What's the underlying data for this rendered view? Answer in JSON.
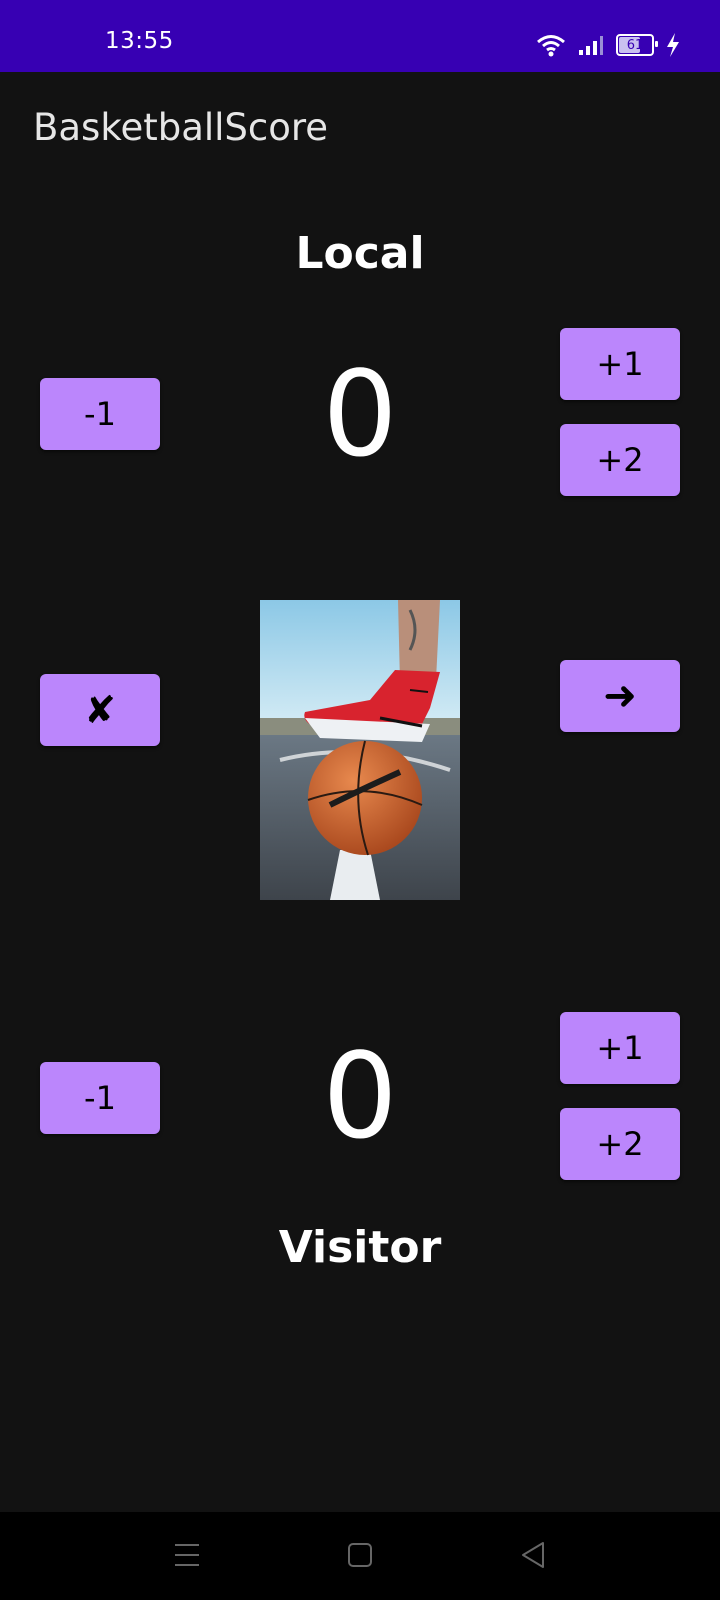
{
  "status_bar": {
    "time": "13:55",
    "battery_level": "61",
    "icons": [
      "wifi-icon",
      "signal-icon",
      "battery-icon",
      "charging-icon"
    ]
  },
  "app": {
    "title": "BasketballScore"
  },
  "local": {
    "team_name": "Local",
    "score": "0",
    "minus_one_label": "-1",
    "plus_one_label": "+1",
    "plus_two_label": "+2"
  },
  "controls": {
    "reset_icon": "✘",
    "next_icon": "➜"
  },
  "visitor": {
    "team_name": "Visitor",
    "score": "0",
    "minus_one_label": "-1",
    "plus_one_label": "+1",
    "plus_two_label": "+2"
  },
  "image": {
    "subject": "basketball-sneaker-photo"
  },
  "nav_bar": {
    "icons": [
      "menu-icon",
      "home-icon",
      "back-icon"
    ]
  },
  "colors": {
    "status_bar": "#3700b3",
    "background": "#121212",
    "button": "#bb86fc",
    "nav_bar": "#000000"
  }
}
